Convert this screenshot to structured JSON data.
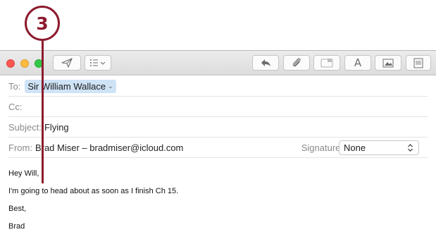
{
  "callout": {
    "number": "3",
    "color": "#8c1b2e"
  },
  "toolbar": {
    "send_icon": "paper-plane-icon",
    "header_fields_icon": "list-icon",
    "reply_icon": "reply-arrow-icon",
    "attach_icon": "paperclip-icon",
    "markup_icon": "markup-icon",
    "format_label": "A",
    "photo_icon": "photo-browser-icon",
    "template_icon": "stationery-icon"
  },
  "header": {
    "to_label": "To:",
    "to_value": "Sir William Wallace",
    "cc_label": "Cc:",
    "subject_label": "Subject:",
    "subject_value": "Flying",
    "from_label": "From:",
    "from_value": "Brad Miser – bradmiser@icloud.com",
    "signature_label": "Signature:",
    "signature_value": "None"
  },
  "message": {
    "lines": [
      "Hey Will,",
      "I'm going to head about as soon as I finish Ch 15.",
      "Best,",
      "Brad"
    ]
  },
  "colors": {
    "recipient_highlight": "#cfe3f7",
    "close": "#fc5753",
    "minimize": "#fdbc40",
    "zoom": "#33c748"
  }
}
